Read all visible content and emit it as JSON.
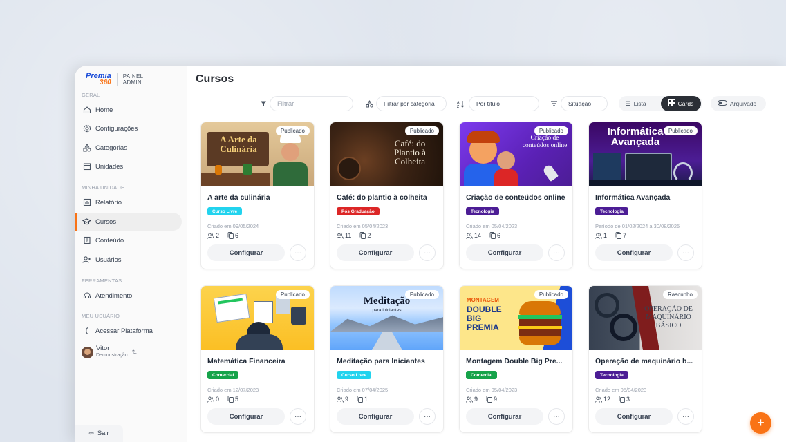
{
  "brand": {
    "logo_line1": "Premia",
    "logo_line2": "360",
    "panel_line1": "PAINEL",
    "panel_line2": "ADMIN"
  },
  "sidebar": {
    "sections": [
      "GERAL",
      "MINHA UNIDADE",
      "FERRAMENTAS",
      "MEU USUÁRIO"
    ],
    "items": [
      {
        "label": "Home",
        "icon": "home-icon"
      },
      {
        "label": "Configurações",
        "icon": "gear-icon"
      },
      {
        "label": "Categorias",
        "icon": "shapes-icon"
      },
      {
        "label": "Unidades",
        "icon": "store-icon"
      },
      {
        "label": "Relatório",
        "icon": "chart-icon"
      },
      {
        "label": "Cursos",
        "icon": "graduation-cap-icon"
      },
      {
        "label": "Conteúdo",
        "icon": "document-icon"
      },
      {
        "label": "Usuários",
        "icon": "user-plus-icon"
      },
      {
        "label": "Atendimento",
        "icon": "headset-icon"
      },
      {
        "label": "Acessar Plataforma",
        "icon": "external-link-icon"
      }
    ],
    "active_item": "Cursos",
    "user": {
      "name": "Vitor",
      "role": "Demonstração"
    },
    "logout_label": "Sair"
  },
  "main": {
    "title": "Cursos",
    "filters": {
      "search_placeholder": "Filtrar",
      "category_label": "Filtrar por categoria",
      "title_placeholder": "Por título",
      "status_label": "Situação"
    },
    "view": {
      "list_label": "Lista",
      "cards_label": "Cards",
      "selected": "Cards"
    },
    "archived_label": "Arquivado"
  },
  "courses": [
    {
      "title": "A arte da culinária",
      "status": "Publicado",
      "tag": "Curso Livre",
      "tag_color": "#22d3ee",
      "date": "Criado em 09/05/2024",
      "users": "2",
      "contents": "6",
      "thumb_text": "A Arte da Culinária"
    },
    {
      "title": "Café: do plantio à colheita",
      "status": "Publicado",
      "tag": "Pós Graduação",
      "tag_color": "#dc2626",
      "date": "Criado em 05/04/2023",
      "users": "11",
      "contents": "2",
      "thumb_text": "Café: do Plantio à Colheita"
    },
    {
      "title": "Criação de conteúdos online",
      "status": "Publicado",
      "tag": "Tecnologia",
      "tag_color": "#4c1d95",
      "date": "Criado em 05/04/2023",
      "users": "14",
      "contents": "6",
      "thumb_text": "Criação de conteúdos online"
    },
    {
      "title": "Informática Avançada",
      "status": "Publicado",
      "tag": "Tecnologia",
      "tag_color": "#4c1d95",
      "date": "Período de 01/02/2024 à 30/08/2025",
      "users": "1",
      "contents": "7",
      "thumb_text": "Informática Avançada"
    },
    {
      "title": "Matemática Financeira",
      "status": "Publicado",
      "tag": "Comercial",
      "tag_color": "#16a34a",
      "date": "Criado em 12/07/2023",
      "users": "0",
      "contents": "5",
      "thumb_text": ""
    },
    {
      "title": "Meditação para Iniciantes",
      "status": "Publicado",
      "tag": "Curso Livre",
      "tag_color": "#22d3ee",
      "date": "Criado em 07/04/2025",
      "users": "9",
      "contents": "1",
      "thumb_text": "Meditação",
      "thumb_sub": "para iniciantes"
    },
    {
      "title": "Montagem Double Big Pre...",
      "status": "Publicado",
      "tag": "Comercial",
      "tag_color": "#16a34a",
      "date": "Criado em 05/04/2023",
      "users": "9",
      "contents": "9",
      "thumb_text": "DOUBLE BIG PREMIA",
      "thumb_sub": "MONTAGEM"
    },
    {
      "title": "Operação de maquinário b...",
      "status": "Rascunho",
      "tag": "Tecnologia",
      "tag_color": "#4c1d95",
      "date": "Criado em 05/04/2023",
      "users": "12",
      "contents": "3",
      "thumb_text": "OPERAÇÃO DE MAQUINÁRIO BÁSICO"
    }
  ],
  "card_actions": {
    "configure_label": "Configurar",
    "more_label": "···"
  },
  "fab_label": "+",
  "colors": {
    "accent": "#f97316",
    "dark": "#2b2f36"
  }
}
